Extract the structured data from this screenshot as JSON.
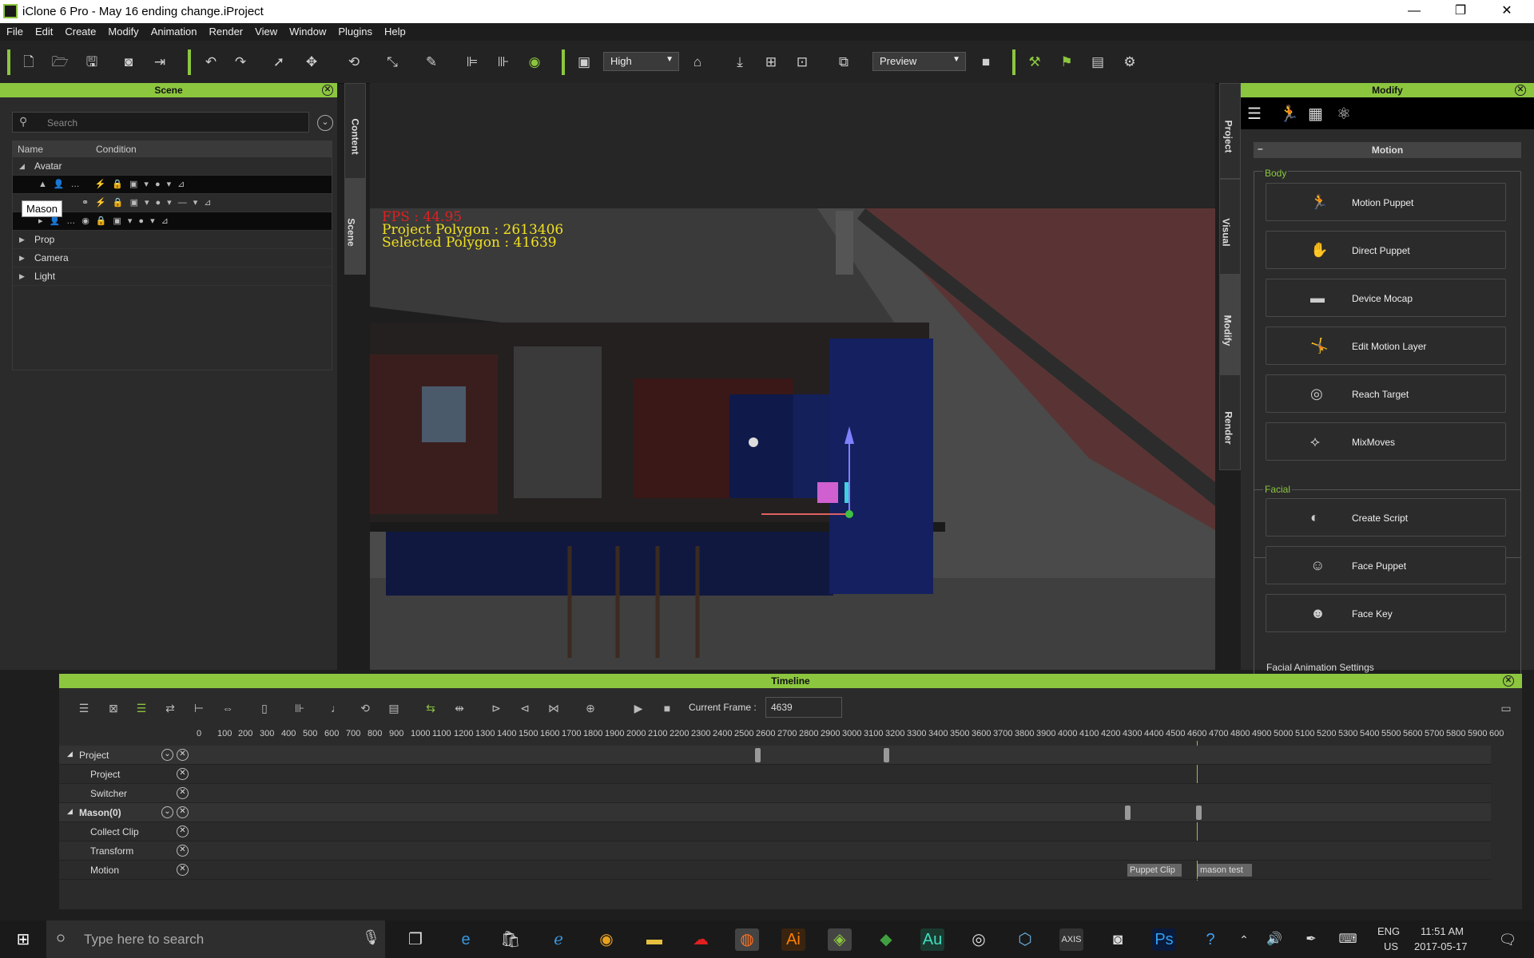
{
  "window": {
    "title": "iClone 6 Pro - May 16 ending change.iProject",
    "min": "—",
    "max": "❐",
    "close": "✕"
  },
  "menu": [
    "File",
    "Edit",
    "Create",
    "Modify",
    "Animation",
    "Render",
    "View",
    "Window",
    "Plugins",
    "Help"
  ],
  "toolbar": {
    "quality": "High",
    "render_mode": "Preview"
  },
  "scene": {
    "title": "Scene",
    "search_placeholder": "Search",
    "col_name": "Name",
    "col_condition": "Condition",
    "avatar": "Avatar",
    "tooltip": "Mason",
    "rows": [
      "Prop",
      "Camera",
      "Light"
    ]
  },
  "side_tabs_left": [
    "Content",
    "Scene"
  ],
  "side_tabs_right": [
    "Project",
    "Visual",
    "Modify",
    "Render"
  ],
  "viewport": {
    "fps": "FPS : 44.95",
    "project_polygon": "Project Polygon : 2613406",
    "selected_polygon": "Selected Polygon : 41639"
  },
  "modify": {
    "title": "Modify",
    "section": "Motion",
    "body_label": "Body",
    "facial_label": "Facial",
    "facial_settings": "Facial Animation Settings",
    "body": [
      {
        "label": "Motion Puppet",
        "icon": "motion-puppet-icon"
      },
      {
        "label": "Direct Puppet",
        "icon": "direct-puppet-icon"
      },
      {
        "label": "Device Mocap",
        "icon": "device-mocap-icon"
      },
      {
        "label": "Edit Motion Layer",
        "icon": "edit-motion-layer-icon"
      },
      {
        "label": "Reach Target",
        "icon": "reach-target-icon"
      },
      {
        "label": "MixMoves",
        "icon": "mixmoves-icon"
      }
    ],
    "facial": [
      {
        "label": "Create Script",
        "icon": "create-script-icon"
      },
      {
        "label": "Face Puppet",
        "icon": "face-puppet-icon"
      },
      {
        "label": "Face Key",
        "icon": "face-key-icon"
      }
    ]
  },
  "timeline": {
    "title": "Timeline",
    "current_frame_label": "Current Frame :",
    "current_frame": "4639",
    "ruler": [
      "0",
      "100",
      "200",
      "300",
      "400",
      "500",
      "600",
      "700",
      "800",
      "900",
      "1000",
      "1100",
      "1200",
      "1300",
      "1400",
      "1500",
      "1600",
      "1700",
      "1800",
      "1900",
      "2000",
      "2100",
      "2200",
      "2300",
      "2400",
      "2500",
      "2600",
      "2700",
      "2800",
      "2900",
      "3000",
      "3100",
      "3200",
      "3300",
      "3400",
      "3500",
      "3600",
      "3700",
      "3800",
      "3900",
      "4000",
      "4100",
      "4200",
      "4300",
      "4400",
      "4500",
      "4600",
      "4700",
      "4800",
      "4900",
      "5000",
      "5100",
      "5200",
      "5300",
      "5400",
      "5500",
      "5600",
      "5700",
      "5800",
      "5900",
      "600"
    ],
    "tracks": [
      "Project",
      "Project",
      "Switcher",
      "Mason(0)",
      "Collect Clip",
      "Transform",
      "Motion"
    ],
    "clips": [
      "Puppet Clip",
      "mason test"
    ]
  },
  "taskbar": {
    "search_placeholder": "Type here to search",
    "lang": "ENG",
    "region": "US",
    "time": "11:51 AM",
    "date": "2017-05-17"
  }
}
